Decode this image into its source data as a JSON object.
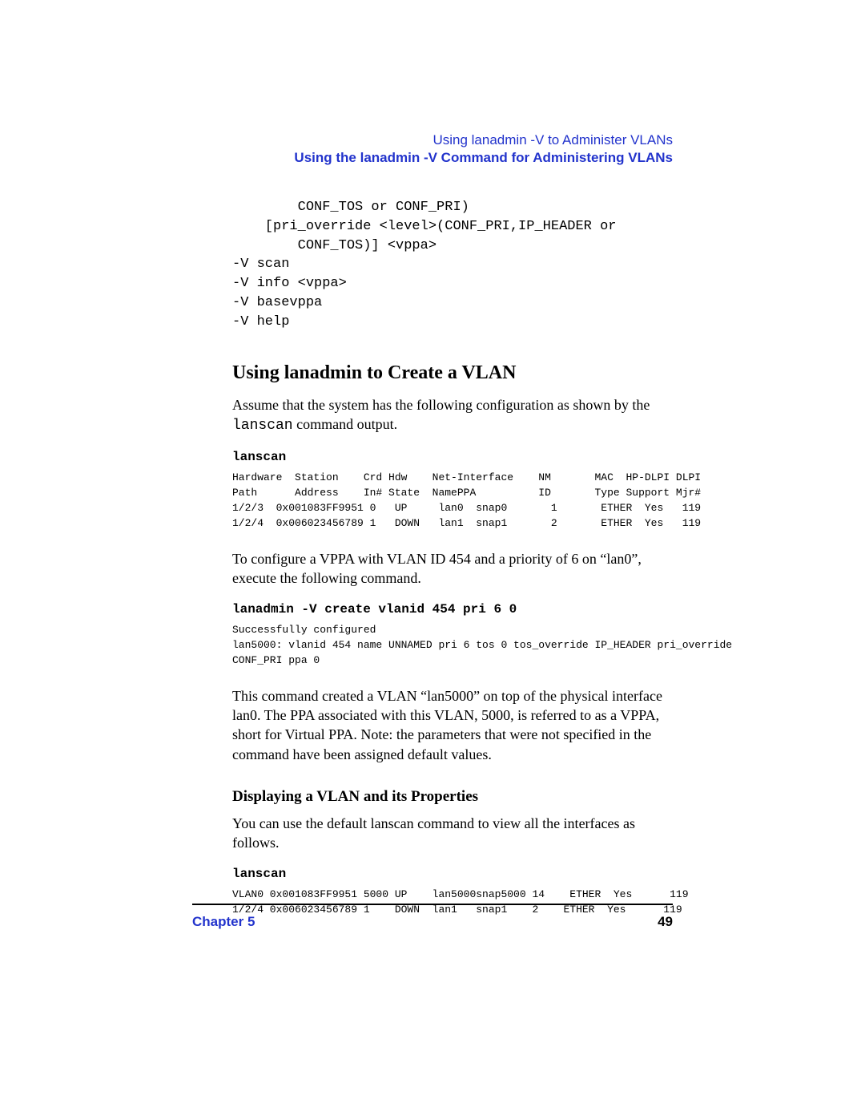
{
  "header": {
    "line1": "Using lanadmin -V to Administer VLANs",
    "line2": "Using the lanadmin -V Command for Administering VLANs"
  },
  "code_intro": "        CONF_TOS or CONF_PRI)\n    [pri_override <level>(CONF_PRI,IP_HEADER or\n        CONF_TOS)] <vppa>\n-V scan\n-V info <vppa>\n-V basevppa\n-V help",
  "section_title": "Using lanadmin to Create a VLAN",
  "para1_pre": "Assume that the system has the following configuration as shown by the ",
  "para1_code": "lanscan",
  "para1_post": " command output.",
  "cmd1": "lanscan",
  "lanscan1": "Hardware  Station    Crd Hdw    Net-Interface    NM       MAC  HP-DLPI DLPI\nPath      Address    In# State  NamePPA          ID       Type Support Mjr#\n1/2/3  0x001083FF9951 0   UP     lan0  snap0       1       ETHER  Yes   119\n1/2/4  0x006023456789 1   DOWN   lan1  snap1       2       ETHER  Yes   119",
  "para2": "To configure a VPPA with VLAN ID 454 and a priority of 6 on “lan0”, execute the following command.",
  "cmd2": "lanadmin -V create vlanid 454 pri 6 0",
  "output2": "Successfully configured\nlan5000: vlanid 454 name UNNAMED pri 6 tos 0 tos_override IP_HEADER pri_override\nCONF_PRI ppa 0",
  "para3": "This command created a VLAN “lan5000” on top of the physical interface lan0. The PPA associated with this VLAN, 5000, is referred to as a VPPA, short for Virtual PPA. Note: the parameters that were not specified in the command have been assigned default values.",
  "subhead": "Displaying a VLAN and its Properties",
  "para4": "You can use the default lanscan command to view all the interfaces as follows.",
  "cmd3": "lanscan",
  "lanscan3": "VLAN0 0x001083FF9951 5000 UP    lan5000snap5000 14    ETHER  Yes      119\n1/2/4 0x006023456789 1    DOWN  lan1   snap1    2    ETHER  Yes      119",
  "footer": {
    "chapter": "Chapter 5",
    "page": "49"
  }
}
